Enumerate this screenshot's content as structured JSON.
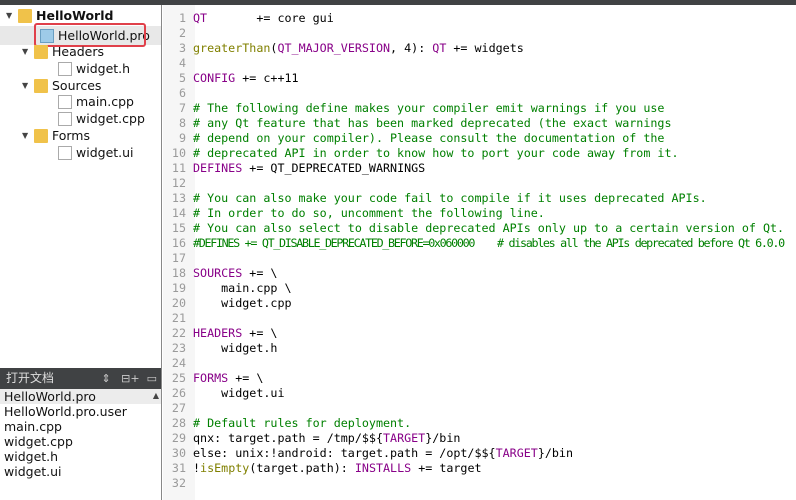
{
  "project_tree": {
    "root": "HelloWorld",
    "pro_file": "HelloWorld.pro",
    "groups": [
      {
        "label": "Headers",
        "files": [
          "widget.h"
        ]
      },
      {
        "label": "Sources",
        "files": [
          "main.cpp",
          "widget.cpp"
        ]
      },
      {
        "label": "Forms",
        "files": [
          "widget.ui"
        ]
      }
    ]
  },
  "open_documents": {
    "title": "打开文档",
    "files": [
      "HelloWorld.pro",
      "HelloWorld.pro.user",
      "main.cpp",
      "widget.cpp",
      "widget.h",
      "widget.ui"
    ]
  },
  "editor": {
    "lines": [
      [
        [
          "QT",
          "k"
        ],
        [
          "       += core gui",
          "n"
        ]
      ],
      [],
      [
        [
          "greaterThan",
          "f"
        ],
        [
          "(",
          "n"
        ],
        [
          "QT_MAJOR_VERSION",
          "k"
        ],
        [
          ", 4): ",
          "n"
        ],
        [
          "QT",
          "k"
        ],
        [
          " += widgets",
          "n"
        ]
      ],
      [],
      [
        [
          "CONFIG",
          "k"
        ],
        [
          " += c++11",
          "n"
        ]
      ],
      [],
      [
        [
          "# The following define makes your compiler emit warnings if you use",
          "g"
        ]
      ],
      [
        [
          "# any Qt feature that has been marked deprecated (the exact warnings",
          "g"
        ]
      ],
      [
        [
          "# depend on your compiler). Please consult the documentation of the",
          "g"
        ]
      ],
      [
        [
          "# deprecated API in order to know how to port your code away from it.",
          "g"
        ]
      ],
      [
        [
          "DEFINES",
          "k"
        ],
        [
          " += QT_DEPRECATED_WARNINGS",
          "n"
        ]
      ],
      [],
      [
        [
          "# You can also make your code fail to compile if it uses deprecated APIs.",
          "g"
        ]
      ],
      [
        [
          "# In order to do so, uncomment the following line.",
          "g"
        ]
      ],
      [
        [
          "# You can also select to disable deprecated APIs only up to a certain version of Qt.",
          "g"
        ]
      ],
      [
        [
          "#DEFINES += QT_DISABLE_DEPRECATED_BEFORE=0x060000    # disables all the APIs deprecated before Qt 6.0.0",
          "g"
        ]
      ],
      [],
      [
        [
          "SOURCES",
          "k"
        ],
        [
          " += \\",
          "n"
        ]
      ],
      [
        [
          "    main.cpp \\",
          "n"
        ]
      ],
      [
        [
          "    widget.cpp",
          "n"
        ]
      ],
      [],
      [
        [
          "HEADERS",
          "k"
        ],
        [
          " += \\",
          "n"
        ]
      ],
      [
        [
          "    widget.h",
          "n"
        ]
      ],
      [],
      [
        [
          "FORMS",
          "k"
        ],
        [
          " += \\",
          "n"
        ]
      ],
      [
        [
          "    widget.ui",
          "n"
        ]
      ],
      [],
      [
        [
          "# Default rules for deployment.",
          "g"
        ]
      ],
      [
        [
          "qnx: target.path = /tmp/$${",
          "n"
        ],
        [
          "TARGET",
          "k"
        ],
        [
          "}/bin",
          "n"
        ]
      ],
      [
        [
          "else: unix:!android: target.path = /opt/$${",
          "n"
        ],
        [
          "TARGET",
          "k"
        ],
        [
          "}/bin",
          "n"
        ]
      ],
      [
        [
          "!",
          "n"
        ],
        [
          "isEmpty",
          "f"
        ],
        [
          "(target.path): ",
          "n"
        ],
        [
          "INSTALLS",
          "k"
        ],
        [
          " += target",
          "n"
        ]
      ],
      []
    ]
  }
}
